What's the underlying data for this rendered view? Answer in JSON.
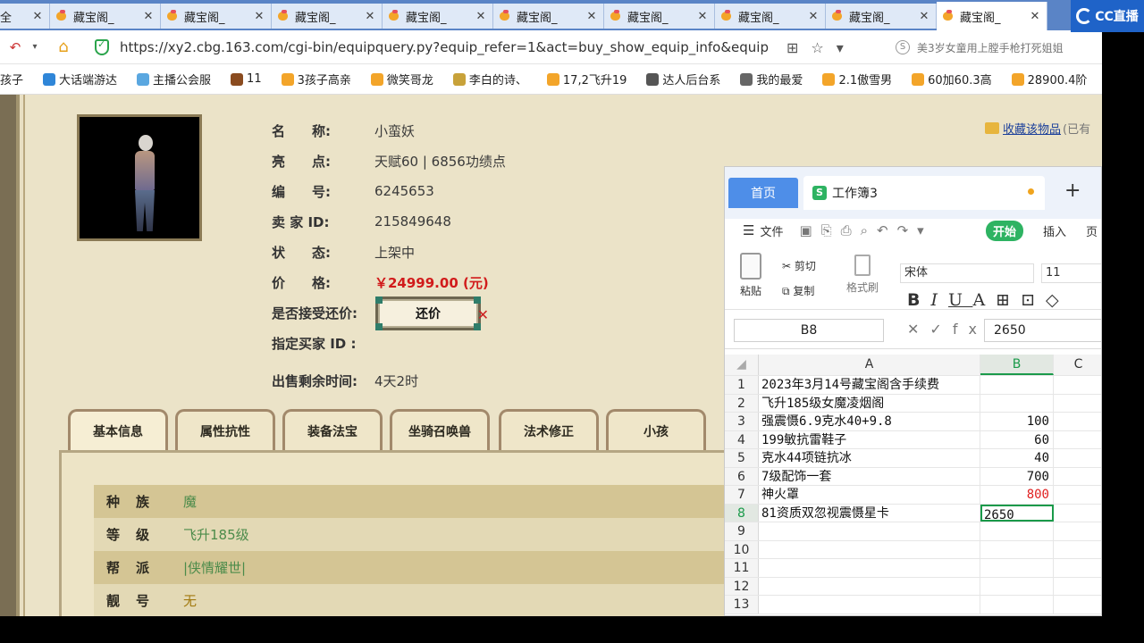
{
  "browser": {
    "tabs": [
      {
        "label": "全",
        "partial": true
      },
      {
        "label": "藏宝阁_"
      },
      {
        "label": "藏宝阁_"
      },
      {
        "label": "藏宝阁_"
      },
      {
        "label": "藏宝阁_"
      },
      {
        "label": "藏宝阁_"
      },
      {
        "label": "藏宝阁_"
      },
      {
        "label": "藏宝阁_"
      },
      {
        "label": "藏宝阁_"
      },
      {
        "label": "藏宝阁_",
        "active": true
      }
    ],
    "brand": "CC直播",
    "url": "https://xy2.cbg.163.com/cgi-bin/equipquery.py?equip_refer=1&act=buy_show_equip_info&equip",
    "search_text": "美3岁女童用上膛手枪打死姐姐",
    "bookmarks": [
      "孩子",
      "大话端游达",
      "主播公会服",
      "11",
      "3孩子高亲",
      "微笑哥龙",
      "李白的诗、",
      "17,2飞升19",
      "达人后台系",
      "我的最爱",
      "2.1傲雪男",
      "60加60.3高",
      "28900.4阶"
    ]
  },
  "listing": {
    "rows": [
      {
        "label": "名　　称:",
        "value": "小蛮妖"
      },
      {
        "label": "亮　　点:",
        "value": "天赋60 | 6856功绩点"
      },
      {
        "label": "编　　号:",
        "value": "6245653"
      },
      {
        "label": "卖 家 ID:",
        "value": "215849648"
      },
      {
        "label": "状　　态:",
        "value": "上架中"
      },
      {
        "label": "价　　格:",
        "value": "￥24999.00 (元)",
        "price": true
      },
      {
        "label": "是否接受还价:",
        "value": ""
      },
      {
        "label": "指定买家 ID :",
        "value": ""
      },
      {
        "label": "出售剩余时间:",
        "value": "4天2时"
      }
    ],
    "counter_offer_button": "还价",
    "favorite_link": "收藏该物品",
    "favorite_extra": "(已有"
  },
  "game_tabs": [
    "基本信息",
    "属性抗性",
    "装备法宝",
    "坐骑召唤兽",
    "法术修正",
    "小孩"
  ],
  "attributes": [
    {
      "label": "种族",
      "value": "魔",
      "color": "#4b8b4a"
    },
    {
      "label": "等级",
      "value": "飞升185级",
      "color": "#4b8b4a"
    },
    {
      "label": "帮派",
      "value": "|侠情耀世|",
      "color": "#4b8b4a"
    },
    {
      "label": "靓号",
      "value": "无",
      "color": "#a27a10"
    }
  ],
  "spreadsheet": {
    "home_tab": "首页",
    "doc_title": "工作簿3",
    "menu": {
      "file": "文件",
      "start": "开始",
      "insert": "插入",
      "page": "页"
    },
    "ribbon": {
      "paste": "粘贴",
      "cut": "剪切",
      "copy": "复制",
      "format_painter": "格式刷",
      "font": "宋体",
      "font_size": "11"
    },
    "cell_ref": "B8",
    "formula_value": "2650",
    "columns": [
      "A",
      "B",
      "C"
    ],
    "rows": [
      {
        "n": "1",
        "a": "2023年3月14号藏宝阁含手续费",
        "b": ""
      },
      {
        "n": "2",
        "a": "飞升185级女魔凌烟阁",
        "b": ""
      },
      {
        "n": "3",
        "a": "强震慑6.9克水40+9.8",
        "b": "100"
      },
      {
        "n": "4",
        "a": "199敏抗雷鞋子",
        "b": "60"
      },
      {
        "n": "5",
        "a": "克水44项链抗冰",
        "b": "40"
      },
      {
        "n": "6",
        "a": "7级配饰一套",
        "b": "700"
      },
      {
        "n": "7",
        "a": "神火罩",
        "b": "800",
        "red": true
      },
      {
        "n": "8",
        "a": "81资质双忽视震慑星卡",
        "b": "2650",
        "selected": true
      },
      {
        "n": "9",
        "a": "",
        "b": ""
      },
      {
        "n": "10",
        "a": "",
        "b": ""
      },
      {
        "n": "11",
        "a": "",
        "b": ""
      },
      {
        "n": "12",
        "a": "",
        "b": ""
      },
      {
        "n": "13",
        "a": "",
        "b": ""
      }
    ]
  }
}
